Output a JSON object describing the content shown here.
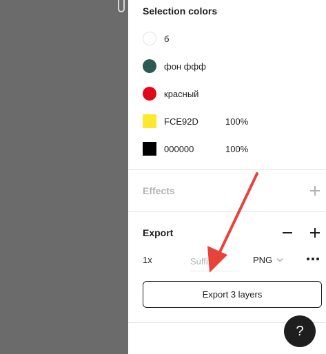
{
  "selection_colors": {
    "title": "Selection colors",
    "items": [
      {
        "name": "б",
        "shape": "circle",
        "color": "#ffffff"
      },
      {
        "name": "фон ффф",
        "shape": "circle",
        "color": "#2e5a54"
      },
      {
        "name": "красный",
        "shape": "circle",
        "color": "#e2071b"
      },
      {
        "name": "FCE92D",
        "opacity": "100%",
        "shape": "square",
        "color": "#fce92d"
      },
      {
        "name": "000000",
        "opacity": "100%",
        "shape": "square",
        "color": "#000000"
      }
    ]
  },
  "effects": {
    "title": "Effects",
    "add_icon": "plus-icon"
  },
  "export": {
    "title": "Export",
    "remove_icon": "minus-icon",
    "add_icon": "plus-icon",
    "scale": "1x",
    "suffix_value": "",
    "suffix_placeholder": "Suffix",
    "format": "PNG",
    "more_icon": "more-horizontal-icon",
    "button_label": "Export 3 layers"
  },
  "help_button": {
    "label": "?"
  },
  "annotation": {
    "icon": "red-arrow",
    "color": "#e8423a"
  },
  "colors": {
    "canvas_bg": "#6b6b6b",
    "panel_bg": "#ffffff",
    "text": "#1e1e1e",
    "muted": "#b3b3b3"
  }
}
